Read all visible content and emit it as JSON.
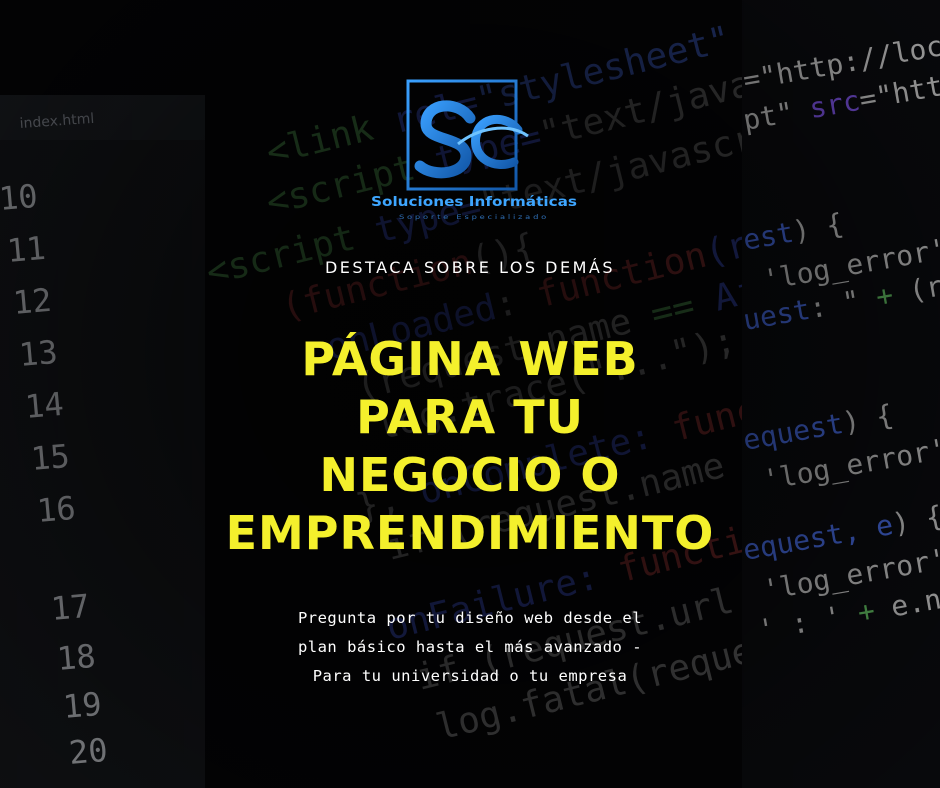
{
  "logo": {
    "brand": "Soluciones Informáticas",
    "tagline": "Soporte Especializado",
    "icon": "sc-monogram-icon"
  },
  "tagline": "DESTACA SOBRE LOS DEMÁS",
  "headline": [
    "PÁGINA WEB",
    "PARA TU",
    "NEGOCIO O",
    "EMPRENDIMIENTO"
  ],
  "description": [
    "Pregunta por tu diseño web desde el",
    "plan básico hasta el más avanzado -",
    "Para tu universidad o tu empresa"
  ],
  "colors": {
    "headline": "#f4f02c",
    "logo_blue": "#1f7fd6",
    "background": "#050507"
  }
}
